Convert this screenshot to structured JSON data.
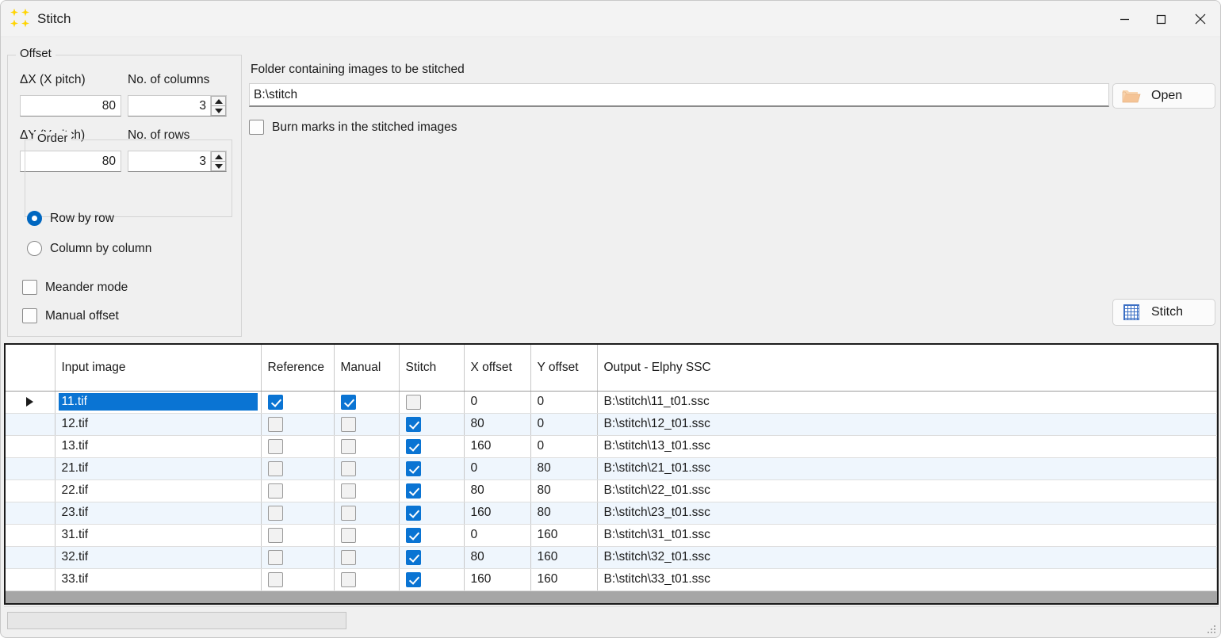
{
  "window": {
    "title": "Stitch",
    "icon": "stitch-grid-icon",
    "minimize_label": "Minimize",
    "maximize_label": "Maximize",
    "close_label": "Close"
  },
  "offset_panel": {
    "legend": "Offset",
    "x_pitch_label": "ΔX (X pitch)",
    "x_pitch_value": "80",
    "y_pitch_label": "ΔY (Y pitch)",
    "y_pitch_value": "80",
    "columns_label": "No. of columns",
    "columns_value": "3",
    "rows_label": "No. of rows",
    "rows_value": "3",
    "order": {
      "legend": "Order",
      "options": [
        {
          "label": "Row by row",
          "selected": true
        },
        {
          "label": "Column by column",
          "selected": false
        }
      ]
    },
    "checkboxes": [
      {
        "label": "Meander mode",
        "checked": false
      },
      {
        "label": "Manual offset",
        "checked": false
      }
    ]
  },
  "folder_panel": {
    "label": "Folder containing images to be stitched",
    "path_value": "B:\\stitch",
    "burn_marks_label": "Burn marks in the stitched images",
    "burn_marks_checked": false,
    "open_button_label": "Open",
    "open_button_icon": "folder-open-icon",
    "stitch_button_label": "Stitch",
    "stitch_button_icon": "grid-icon"
  },
  "table": {
    "columns": [
      "",
      "Input image",
      "Reference",
      "Manual",
      "Stitch",
      "X offset",
      "Y offset",
      "Output - Elphy SSC"
    ],
    "rows": [
      {
        "selected": true,
        "input": "11.tif",
        "reference": true,
        "manual": true,
        "stitch": false,
        "x_offset": "0",
        "y_offset": "0",
        "output": "B:\\stitch\\11_t01.ssc"
      },
      {
        "selected": false,
        "input": "12.tif",
        "reference": false,
        "manual": false,
        "stitch": true,
        "x_offset": "80",
        "y_offset": "0",
        "output": "B:\\stitch\\12_t01.ssc"
      },
      {
        "selected": false,
        "input": "13.tif",
        "reference": false,
        "manual": false,
        "stitch": true,
        "x_offset": "160",
        "y_offset": "0",
        "output": "B:\\stitch\\13_t01.ssc"
      },
      {
        "selected": false,
        "input": "21.tif",
        "reference": false,
        "manual": false,
        "stitch": true,
        "x_offset": "0",
        "y_offset": "80",
        "output": "B:\\stitch\\21_t01.ssc"
      },
      {
        "selected": false,
        "input": "22.tif",
        "reference": false,
        "manual": false,
        "stitch": true,
        "x_offset": "80",
        "y_offset": "80",
        "output": "B:\\stitch\\22_t01.ssc"
      },
      {
        "selected": false,
        "input": "23.tif",
        "reference": false,
        "manual": false,
        "stitch": true,
        "x_offset": "160",
        "y_offset": "80",
        "output": "B:\\stitch\\23_t01.ssc"
      },
      {
        "selected": false,
        "input": "31.tif",
        "reference": false,
        "manual": false,
        "stitch": true,
        "x_offset": "0",
        "y_offset": "160",
        "output": "B:\\stitch\\31_t01.ssc"
      },
      {
        "selected": false,
        "input": "32.tif",
        "reference": false,
        "manual": false,
        "stitch": true,
        "x_offset": "80",
        "y_offset": "160",
        "output": "B:\\stitch\\32_t01.ssc"
      },
      {
        "selected": false,
        "input": "33.tif",
        "reference": false,
        "manual": false,
        "stitch": true,
        "x_offset": "160",
        "y_offset": "160",
        "output": "B:\\stitch\\33_t01.ssc"
      }
    ]
  },
  "statusbar": {
    "progress_text": ""
  },
  "colors": {
    "accent": "#0067c0",
    "selection": "#0a74d3",
    "alt_row": "#eff6fd",
    "window_bg": "#f0f0f0",
    "icon_yellow": "#ffd400",
    "folder_icon": "#f5c496",
    "grid_icon": "#3b6fc4"
  }
}
